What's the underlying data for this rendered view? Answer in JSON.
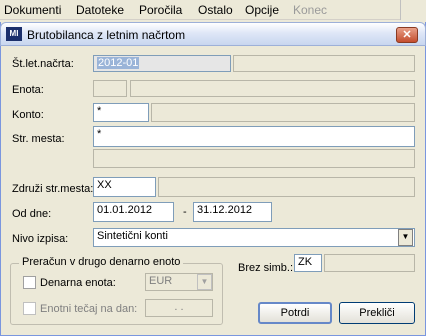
{
  "menu": {
    "items": [
      "Dokumenti",
      "Datoteke",
      "Poročila",
      "Ostalo",
      "Opcije",
      "Konec"
    ]
  },
  "window": {
    "logo": "MI",
    "title": "Brutobilanca z letnim načrtom",
    "close_label": "✕"
  },
  "form": {
    "st_let_nacrta": {
      "label": "Št.let.načrta:",
      "value": "2012-01",
      "desc": ""
    },
    "enota": {
      "label": "Enota:",
      "value": "",
      "desc": ""
    },
    "konto": {
      "label": "Konto:",
      "value": "*",
      "desc": ""
    },
    "str_mesta": {
      "label": "Str. mesta:",
      "value": "*",
      "value2": ""
    },
    "zdruzi": {
      "label": "Združi str.mesta:",
      "value": "XX",
      "desc": ""
    },
    "od_dne": {
      "label": "Od dne:",
      "from": "01.01.2012",
      "sep": "-",
      "to": "31.12.2012"
    },
    "nivo": {
      "label": "Nivo izpisa:",
      "value": "Sintetični konti",
      "arrow": "▼"
    },
    "prerecun": {
      "legend": "Preračun v drugo denarno enoto",
      "denarna_label": "Denarna enota:",
      "denarna_value": "EUR",
      "tecaj_label": "Enotni tečaj na dan:",
      "tecaj_value": ". ."
    },
    "brez_simb": {
      "label": "Brez simb.:",
      "value": "ZK",
      "desc": ""
    }
  },
  "buttons": {
    "potrdi": "Potrdi",
    "preklici": "Prekliči"
  }
}
